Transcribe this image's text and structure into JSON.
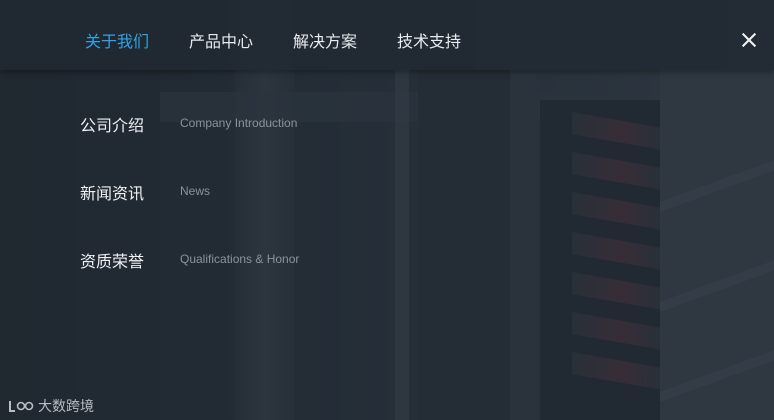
{
  "nav": {
    "items": [
      {
        "label": "关于我们",
        "active": true
      },
      {
        "label": "产品中心",
        "active": false
      },
      {
        "label": "解决方案",
        "active": false
      },
      {
        "label": "技术支持",
        "active": false
      }
    ],
    "active_color": "#2fa3e6",
    "close_icon": "close-icon"
  },
  "submenu": {
    "items": [
      {
        "title": "公司介绍",
        "subtitle": "Company Introduction"
      },
      {
        "title": "新闻资讯",
        "subtitle": "News"
      },
      {
        "title": "资质荣誉",
        "subtitle": "Qualifications & Honor"
      }
    ]
  },
  "watermark": {
    "text": "大数跨境"
  }
}
